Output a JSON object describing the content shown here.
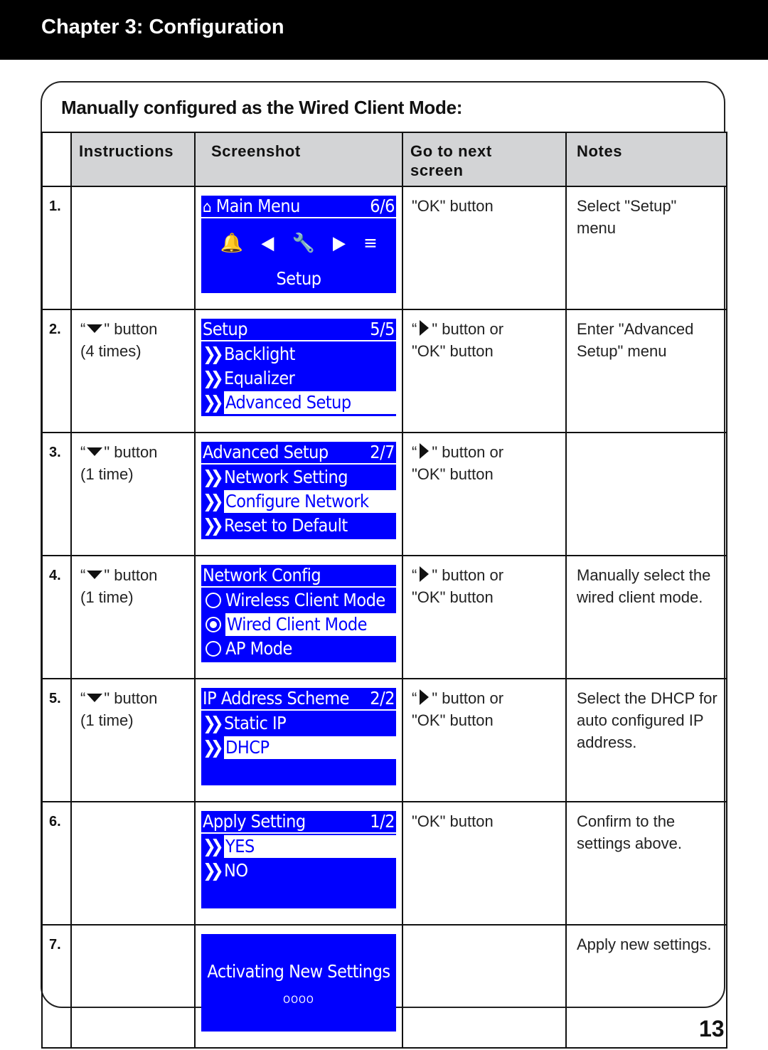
{
  "header": {
    "title": "Chapter 3: Configuration"
  },
  "section_title": "Manually configured as the Wired Client Mode:",
  "table": {
    "headers": [
      "Instructions",
      "Screenshot",
      "Go to next screen",
      "Notes"
    ],
    "rows": [
      {
        "num": "1.",
        "instruction": {
          "icon": "",
          "text": "",
          "times": ""
        },
        "next": {
          "icon": "",
          "line1": "\"OK\" button",
          "line2": ""
        },
        "notes": "Select \"Setup\" menu",
        "screen": {
          "title": "Main Menu",
          "counter": "6/6",
          "title_icon": "home-icon",
          "icons": [
            "bell-icon",
            "left-arrow-icon",
            "wrench-icon",
            "right-arrow-icon",
            "list-icon"
          ],
          "caption": "Setup"
        }
      },
      {
        "num": "2.",
        "instruction": {
          "icon": "down-triangle",
          "text": "\" button",
          "times": "(4 times)"
        },
        "next": {
          "icon": "right-triangle",
          "line1": "\" button or",
          "line2": "\"OK\" button"
        },
        "notes": "Enter \"Advanced Setup\" menu",
        "screen": {
          "title": "Setup",
          "counter": "5/5",
          "items": [
            "Backlight",
            "Equalizer",
            "Advanced Setup"
          ],
          "selected": 2
        }
      },
      {
        "num": "3.",
        "instruction": {
          "icon": "down-triangle",
          "text": "\" button",
          "times": "(1 time)"
        },
        "next": {
          "icon": "right-triangle",
          "line1": "\" button or",
          "line2": "\"OK\" button"
        },
        "notes": "",
        "screen": {
          "title": "Advanced Setup",
          "counter": "2/7",
          "items": [
            "Network Setting",
            "Configure Network",
            "Reset to Default"
          ],
          "selected": 1
        }
      },
      {
        "num": "4.",
        "instruction": {
          "icon": "down-triangle",
          "text": "\" button",
          "times": "(1 time)"
        },
        "next": {
          "icon": "right-triangle",
          "line1": "\" button or",
          "line2": "\"OK\" button"
        },
        "notes": "Manually select the wired client mode.",
        "screen": {
          "title": "Network Config",
          "counter": "",
          "radio_items": [
            "Wireless Client Mode",
            "Wired Client Mode",
            "AP Mode"
          ],
          "selected": 1
        }
      },
      {
        "num": "5.",
        "instruction": {
          "icon": "down-triangle",
          "text": "\" button",
          "times": "(1 time)"
        },
        "next": {
          "icon": "right-triangle",
          "line1": "\" button or",
          "line2": "\"OK\" button"
        },
        "notes": "Select the DHCP for auto configured IP address.",
        "screen": {
          "title": "IP Address Scheme",
          "counter": "2/2",
          "items": [
            "Static IP",
            "DHCP"
          ],
          "selected": 1
        }
      },
      {
        "num": "6.",
        "instruction": {
          "icon": "",
          "text": "",
          "times": ""
        },
        "next": {
          "icon": "",
          "line1": "\"OK\" button",
          "line2": ""
        },
        "notes": "Confirm to the settings above.",
        "screen": {
          "title": "Apply Setting",
          "counter": "1/2",
          "items": [
            "YES",
            "NO"
          ],
          "selected": 0
        }
      },
      {
        "num": "7.",
        "instruction": {
          "icon": "",
          "text": "",
          "times": ""
        },
        "next": {
          "icon": "",
          "line1": "",
          "line2": ""
        },
        "notes": "Apply new settings.",
        "screen": {
          "message": "Activating New Settings",
          "progress": "OOOO"
        }
      }
    ]
  },
  "page_number": "13",
  "colors": {
    "lcd_blue": "#0000ff",
    "header_bg": "#000000",
    "table_header_bg": "#d3d4d6"
  }
}
